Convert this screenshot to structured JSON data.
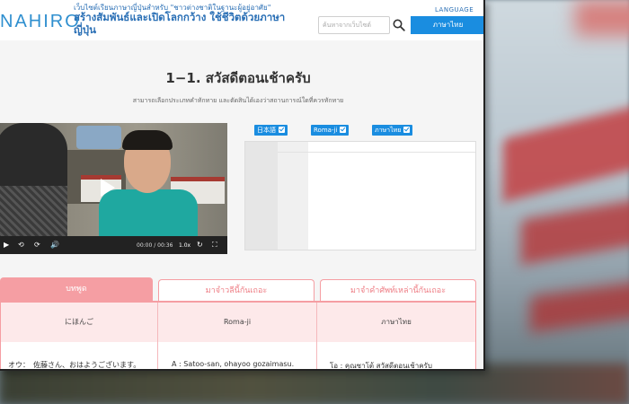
{
  "site": {
    "logo": "NAHIRO",
    "tagline": "เว็บไซต์เรียนภาษาญี่ปุ่นสำหรับ \"ชาวต่างชาติในฐานะผู้อยู่อาศัย\"",
    "headline": "สร้างสัมพันธ์และเปิดโลกกว้าง ใช้ชีวิตด้วยภาษาญี่ปุ่น"
  },
  "search": {
    "placeholder": "ค้นหาจากเว็บไซต์"
  },
  "language": {
    "label": "LANGUAGE",
    "current": "ภาษาไทย"
  },
  "lesson": {
    "title": "1−1.  สวัสดีตอนเช้าครับ",
    "subtitle": "สามารถเลือกประเภทคำทักทาย และตัดสินได้เองว่าสถานการณ์ใดที่ควรทักทาย"
  },
  "video": {
    "time": "00:00 / 00:36",
    "speed": "1.0x"
  },
  "toggles": [
    "日本語",
    "Roma-ji",
    "ภาษาไทย"
  ],
  "tabs": [
    "บทพูด",
    "มาจำวลีนี้กันเถอะ",
    "มาจำคำศัพท์เหล่านี้กันเถอะ"
  ],
  "columns": [
    "にほんご",
    "Roma-ji",
    "ภาษาไทย"
  ],
  "dialogue": {
    "japanese": "オウ：　佐藤さん、おはようございます。",
    "romaji": "A :    Satoo-san, ohayoo gozaimasu.",
    "thai": "โอ :    คุณซาโต้ สวัสดีตอนเช้าครับ"
  },
  "colors": {
    "accent": "#1a8de0",
    "tab_pink": "#f59ea3",
    "brand_blue": "#2f8fcf"
  }
}
